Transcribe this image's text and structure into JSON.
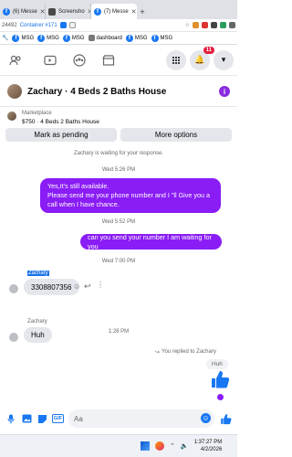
{
  "browser": {
    "tabs": [
      {
        "label": "(6) Messe",
        "icon": "facebook-icon"
      },
      {
        "label": "Screensho",
        "icon": "screenshot-icon"
      },
      {
        "label": "(7) Messe",
        "icon": "facebook-icon"
      }
    ],
    "url_fragment": "24492",
    "container_label": "Container #171",
    "bookmarks": [
      "MSG",
      "MSG",
      "MSG",
      "dashboard",
      "MSG",
      "MSG"
    ]
  },
  "fbnav": {
    "notification_count": "11"
  },
  "chat": {
    "title": "Zachary · 4 Beds 2 Baths House",
    "listing": {
      "category": "Marketplace",
      "name": "$750 · 4 Beds 2 Baths House",
      "btn_pending": "Mark as pending",
      "btn_more": "More options"
    },
    "waiting_text": "Zachary is waiting for your response.",
    "times": {
      "t1": "Wed 5:26 PM",
      "t2": "Wed 5:52 PM",
      "t3": "Wed 7:00 PM",
      "t4": "1:28 PM"
    },
    "out_msg1": "Yes,It's still available.\nPlease send me your phone number and I \"ll Give you a call when I have chance.",
    "out_msg2": "can you send your number I am waiting for you",
    "sender_name": "Zachary",
    "in_msg1": "3308807356",
    "sender_name2": "Zachary",
    "in_msg2": "Huh",
    "reply_label": "You replied to Zachary",
    "reply_quote": "Huh",
    "composer_placeholder": "Aa"
  },
  "taskbar": {
    "time": "1:37:27 PM",
    "date": "4/2/2026"
  },
  "colors": {
    "accent": "#1877f2",
    "bubble_out": "#8a1cf5",
    "bubble_in": "#e4e6eb"
  }
}
